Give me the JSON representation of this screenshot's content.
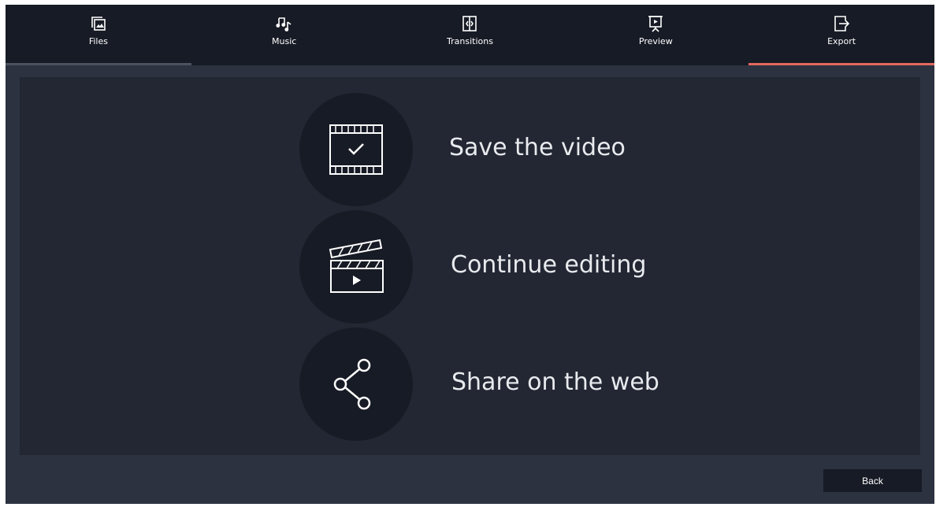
{
  "tabs": [
    {
      "label": "Files",
      "icon": "files-icon",
      "state": "visited"
    },
    {
      "label": "Music",
      "icon": "music-icon",
      "state": "normal"
    },
    {
      "label": "Transitions",
      "icon": "transitions-icon",
      "state": "normal"
    },
    {
      "label": "Preview",
      "icon": "preview-icon",
      "state": "normal"
    },
    {
      "label": "Export",
      "icon": "export-icon",
      "state": "active"
    }
  ],
  "options": [
    {
      "label": "Save the video",
      "icon": "save-video-icon"
    },
    {
      "label": "Continue editing",
      "icon": "clapperboard-icon"
    },
    {
      "label": "Share on the web",
      "icon": "share-icon"
    }
  ],
  "footer": {
    "back_label": "Back"
  },
  "colors": {
    "tabbar_bg": "#171b25",
    "window_bg": "#2c3240",
    "panel_bg": "#222733",
    "active_accent": "#e3685e",
    "visited_accent": "#4a5160"
  }
}
